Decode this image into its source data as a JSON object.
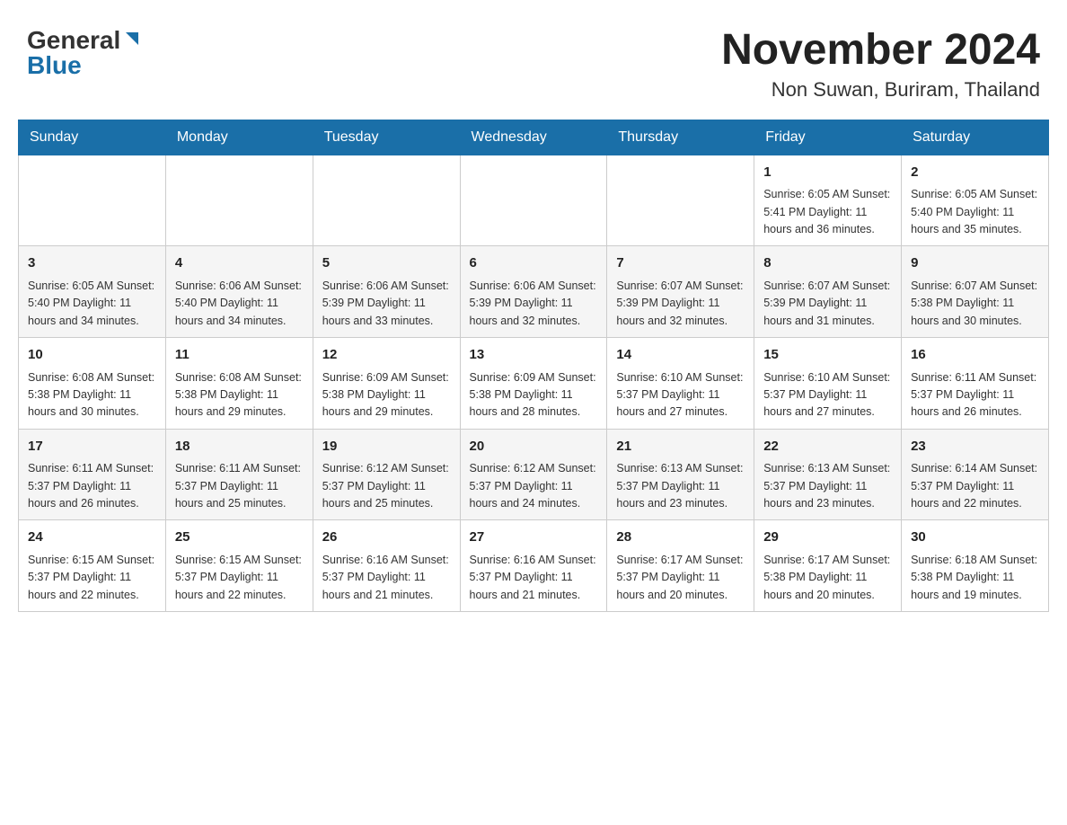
{
  "header": {
    "logo_general": "General",
    "logo_blue": "Blue",
    "main_title": "November 2024",
    "subtitle": "Non Suwan, Buriram, Thailand"
  },
  "calendar": {
    "days_of_week": [
      "Sunday",
      "Monday",
      "Tuesday",
      "Wednesday",
      "Thursday",
      "Friday",
      "Saturday"
    ],
    "weeks": [
      [
        {
          "day": "",
          "info": ""
        },
        {
          "day": "",
          "info": ""
        },
        {
          "day": "",
          "info": ""
        },
        {
          "day": "",
          "info": ""
        },
        {
          "day": "",
          "info": ""
        },
        {
          "day": "1",
          "info": "Sunrise: 6:05 AM\nSunset: 5:41 PM\nDaylight: 11 hours and 36 minutes."
        },
        {
          "day": "2",
          "info": "Sunrise: 6:05 AM\nSunset: 5:40 PM\nDaylight: 11 hours and 35 minutes."
        }
      ],
      [
        {
          "day": "3",
          "info": "Sunrise: 6:05 AM\nSunset: 5:40 PM\nDaylight: 11 hours and 34 minutes."
        },
        {
          "day": "4",
          "info": "Sunrise: 6:06 AM\nSunset: 5:40 PM\nDaylight: 11 hours and 34 minutes."
        },
        {
          "day": "5",
          "info": "Sunrise: 6:06 AM\nSunset: 5:39 PM\nDaylight: 11 hours and 33 minutes."
        },
        {
          "day": "6",
          "info": "Sunrise: 6:06 AM\nSunset: 5:39 PM\nDaylight: 11 hours and 32 minutes."
        },
        {
          "day": "7",
          "info": "Sunrise: 6:07 AM\nSunset: 5:39 PM\nDaylight: 11 hours and 32 minutes."
        },
        {
          "day": "8",
          "info": "Sunrise: 6:07 AM\nSunset: 5:39 PM\nDaylight: 11 hours and 31 minutes."
        },
        {
          "day": "9",
          "info": "Sunrise: 6:07 AM\nSunset: 5:38 PM\nDaylight: 11 hours and 30 minutes."
        }
      ],
      [
        {
          "day": "10",
          "info": "Sunrise: 6:08 AM\nSunset: 5:38 PM\nDaylight: 11 hours and 30 minutes."
        },
        {
          "day": "11",
          "info": "Sunrise: 6:08 AM\nSunset: 5:38 PM\nDaylight: 11 hours and 29 minutes."
        },
        {
          "day": "12",
          "info": "Sunrise: 6:09 AM\nSunset: 5:38 PM\nDaylight: 11 hours and 29 minutes."
        },
        {
          "day": "13",
          "info": "Sunrise: 6:09 AM\nSunset: 5:38 PM\nDaylight: 11 hours and 28 minutes."
        },
        {
          "day": "14",
          "info": "Sunrise: 6:10 AM\nSunset: 5:37 PM\nDaylight: 11 hours and 27 minutes."
        },
        {
          "day": "15",
          "info": "Sunrise: 6:10 AM\nSunset: 5:37 PM\nDaylight: 11 hours and 27 minutes."
        },
        {
          "day": "16",
          "info": "Sunrise: 6:11 AM\nSunset: 5:37 PM\nDaylight: 11 hours and 26 minutes."
        }
      ],
      [
        {
          "day": "17",
          "info": "Sunrise: 6:11 AM\nSunset: 5:37 PM\nDaylight: 11 hours and 26 minutes."
        },
        {
          "day": "18",
          "info": "Sunrise: 6:11 AM\nSunset: 5:37 PM\nDaylight: 11 hours and 25 minutes."
        },
        {
          "day": "19",
          "info": "Sunrise: 6:12 AM\nSunset: 5:37 PM\nDaylight: 11 hours and 25 minutes."
        },
        {
          "day": "20",
          "info": "Sunrise: 6:12 AM\nSunset: 5:37 PM\nDaylight: 11 hours and 24 minutes."
        },
        {
          "day": "21",
          "info": "Sunrise: 6:13 AM\nSunset: 5:37 PM\nDaylight: 11 hours and 23 minutes."
        },
        {
          "day": "22",
          "info": "Sunrise: 6:13 AM\nSunset: 5:37 PM\nDaylight: 11 hours and 23 minutes."
        },
        {
          "day": "23",
          "info": "Sunrise: 6:14 AM\nSunset: 5:37 PM\nDaylight: 11 hours and 22 minutes."
        }
      ],
      [
        {
          "day": "24",
          "info": "Sunrise: 6:15 AM\nSunset: 5:37 PM\nDaylight: 11 hours and 22 minutes."
        },
        {
          "day": "25",
          "info": "Sunrise: 6:15 AM\nSunset: 5:37 PM\nDaylight: 11 hours and 22 minutes."
        },
        {
          "day": "26",
          "info": "Sunrise: 6:16 AM\nSunset: 5:37 PM\nDaylight: 11 hours and 21 minutes."
        },
        {
          "day": "27",
          "info": "Sunrise: 6:16 AM\nSunset: 5:37 PM\nDaylight: 11 hours and 21 minutes."
        },
        {
          "day": "28",
          "info": "Sunrise: 6:17 AM\nSunset: 5:37 PM\nDaylight: 11 hours and 20 minutes."
        },
        {
          "day": "29",
          "info": "Sunrise: 6:17 AM\nSunset: 5:38 PM\nDaylight: 11 hours and 20 minutes."
        },
        {
          "day": "30",
          "info": "Sunrise: 6:18 AM\nSunset: 5:38 PM\nDaylight: 11 hours and 19 minutes."
        }
      ]
    ]
  }
}
